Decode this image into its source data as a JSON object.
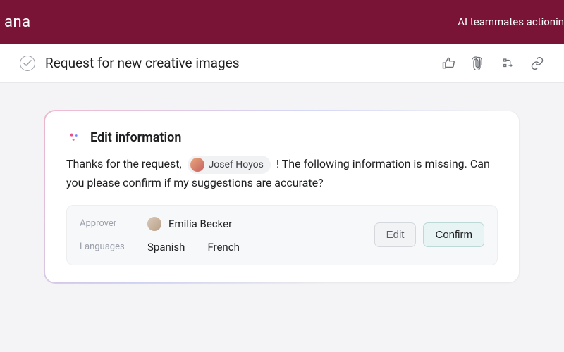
{
  "topbar": {
    "brand": "ana",
    "tagline": "AI teammates actionin"
  },
  "task": {
    "title": "Request for new creative images"
  },
  "card": {
    "title": "Edit information",
    "message_pre": "Thanks for the request, ",
    "mention_name": "Josef Hoyos",
    "message_post": " ! The following information is missing. Can you please confirm if my suggestions are accurate?"
  },
  "fields": {
    "approver_label": "Approver",
    "approver_name": "Emilia Becker",
    "languages_label": "Languages",
    "languages": [
      "Spanish",
      "French"
    ]
  },
  "buttons": {
    "edit": "Edit",
    "confirm": "Confirm"
  }
}
